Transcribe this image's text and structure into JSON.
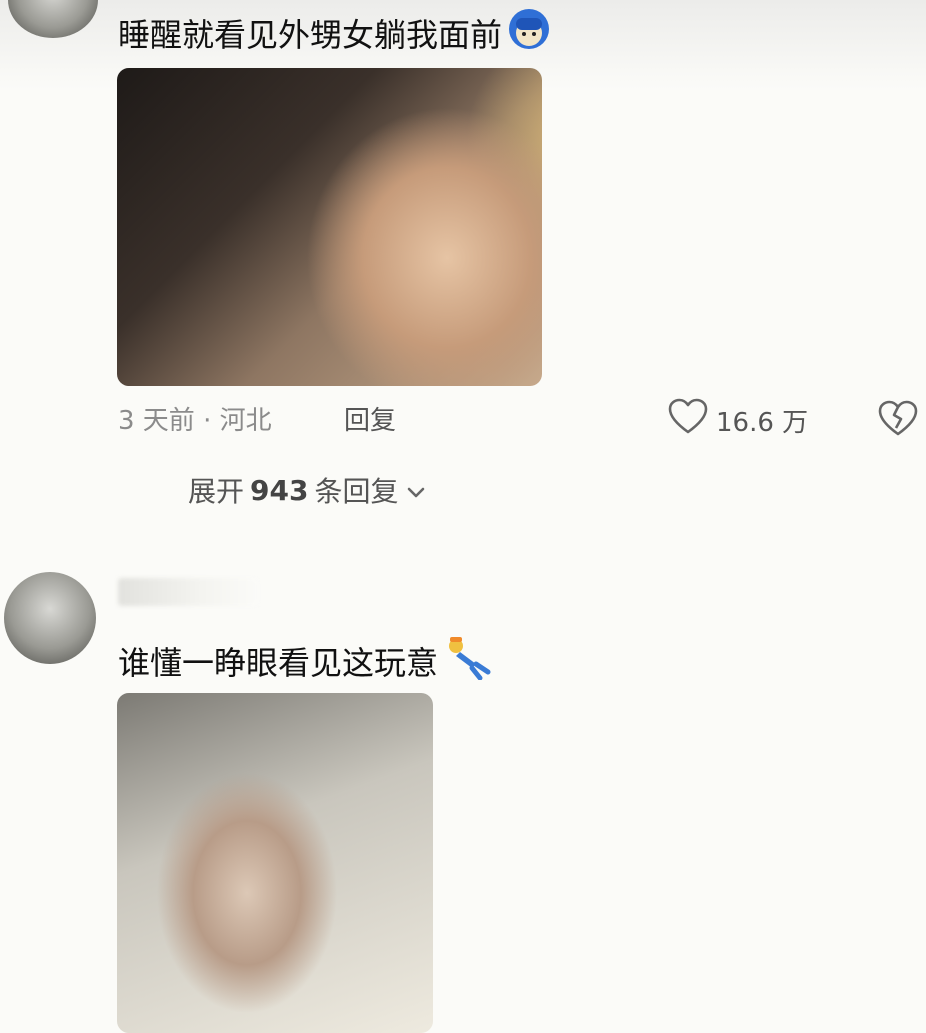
{
  "comments": [
    {
      "text": "睡醒就看见外甥女躺我面前",
      "emoji_icon": "blue-hair-face-emoji-icon",
      "image": "photo-child-lying-smiling",
      "time": "3 天前",
      "separator": "·",
      "location": "河北",
      "reply_label": "回复",
      "like_count": "16.6 万",
      "expand": {
        "prefix": "展开",
        "count": "943",
        "suffix": "条回复"
      }
    },
    {
      "text": "谁懂一睁眼看见这玩意",
      "emoji_icon": "falling-person-emoji-icon",
      "image": "photo-baby-face-closeup"
    }
  ],
  "icons": {
    "like": "heart-outline-icon",
    "dislike": "broken-heart-icon",
    "expand": "chevron-down-icon"
  }
}
